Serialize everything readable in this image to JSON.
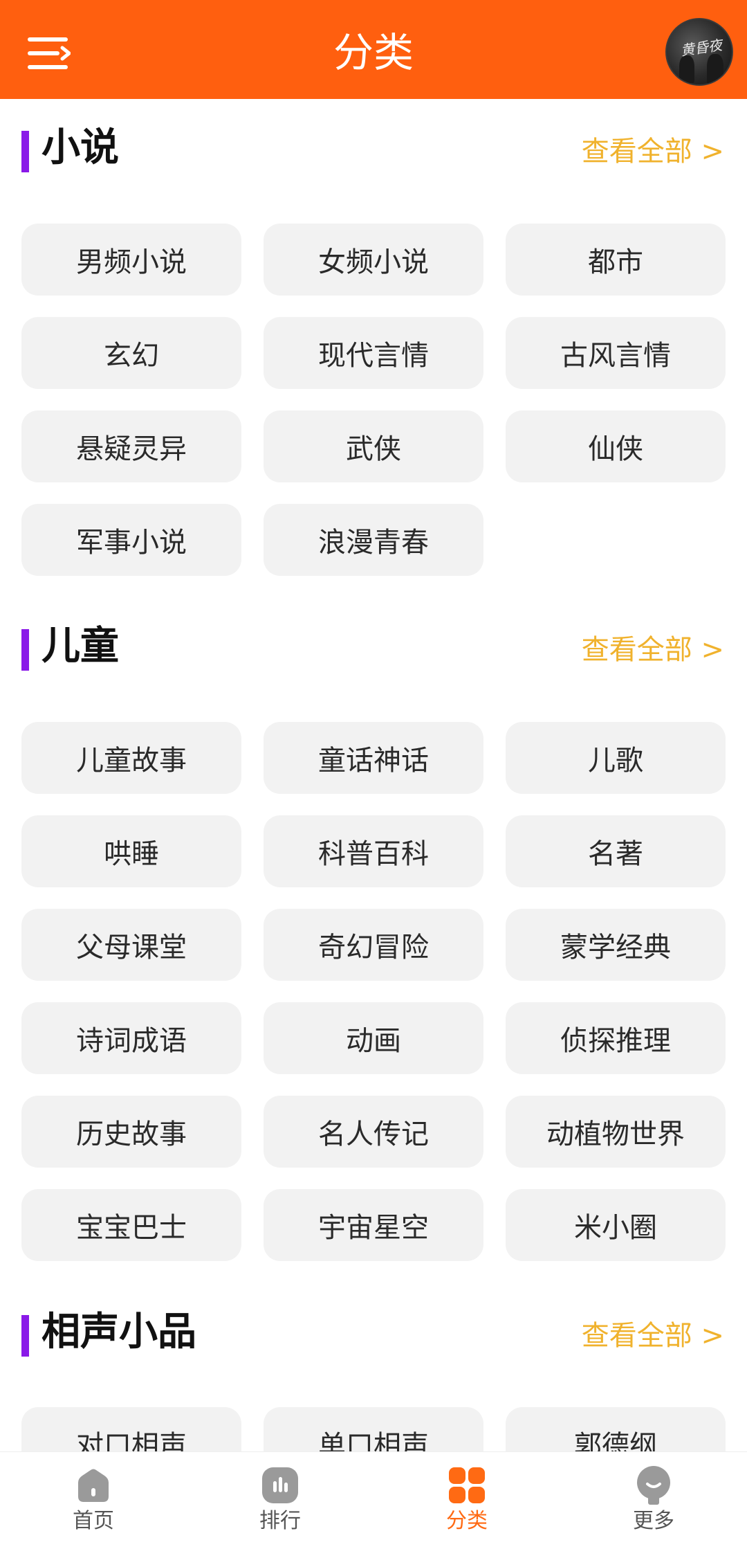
{
  "header": {
    "title": "分类",
    "avatar_text": "黄昏夜"
  },
  "sections": [
    {
      "title": "小说",
      "see_all": "查看全部 >",
      "items": [
        "男频小说",
        "女频小说",
        "都市",
        "玄幻",
        "现代言情",
        "古风言情",
        "悬疑灵异",
        "武侠",
        "仙侠",
        "军事小说",
        "浪漫青春"
      ]
    },
    {
      "title": "儿童",
      "see_all": "查看全部 >",
      "items": [
        "儿童故事",
        "童话神话",
        "儿歌",
        "哄睡",
        "科普百科",
        "名著",
        "父母课堂",
        "奇幻冒险",
        "蒙学经典",
        "诗词成语",
        "动画",
        "侦探推理",
        "历史故事",
        "名人传记",
        "动植物世界",
        "宝宝巴士",
        "宇宙星空",
        "米小圈"
      ]
    },
    {
      "title": "相声小品",
      "see_all": "查看全部 >",
      "items": [
        "对口相声",
        "单口相声",
        "郭德纲"
      ]
    }
  ],
  "tabbar": {
    "items": [
      {
        "label": "首页",
        "icon": "home-icon"
      },
      {
        "label": "排行",
        "icon": "ranking-icon"
      },
      {
        "label": "分类",
        "icon": "category-icon",
        "active": true
      },
      {
        "label": "更多",
        "icon": "more-icon"
      }
    ]
  },
  "colors": {
    "header_bg": "#ff5f0f",
    "section_bar": "#8a19e8",
    "see_all": "#f0b22d",
    "pill_bg": "#f2f2f2",
    "tab_active": "#ff6a13",
    "tab_inactive_icon": "#9a9a9a"
  }
}
